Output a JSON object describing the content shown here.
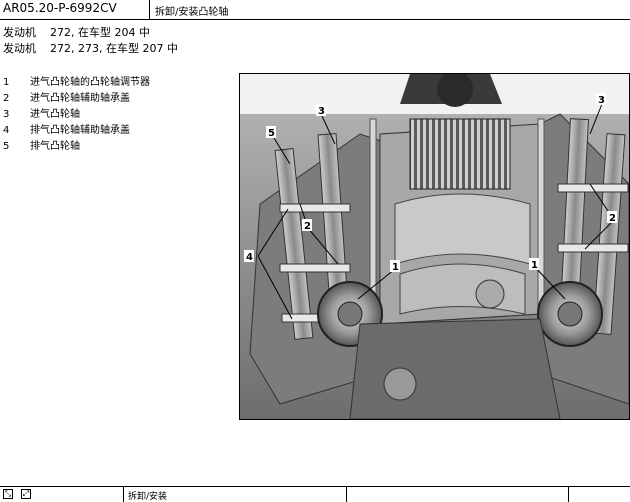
{
  "header": {
    "doc_code": "AR05.20-P-6992CV",
    "title": "拆卸/安装凸轮轴"
  },
  "engines": [
    {
      "key": "发动机",
      "value": "272, 在车型 204 中"
    },
    {
      "key": "发动机",
      "value": "272, 273, 在车型 207 中"
    }
  ],
  "legend": [
    {
      "num": "1",
      "text": "进气凸轮轴的凸轮轴调节器"
    },
    {
      "num": "2",
      "text": "进气凸轮轴辅助轴承盖"
    },
    {
      "num": "3",
      "text": "进气凸轮轴"
    },
    {
      "num": "4",
      "text": "排气凸轮轴辅助轴承盖"
    },
    {
      "num": "5",
      "text": "排气凸轮轴"
    }
  ],
  "figure": {
    "callouts": [
      "5",
      "3",
      "3",
      "2",
      "2",
      "4",
      "1",
      "1"
    ]
  },
  "footer": {
    "label": "拆卸/安装"
  },
  "icons": [
    "fit-screen-icon",
    "fullscreen-icon"
  ]
}
